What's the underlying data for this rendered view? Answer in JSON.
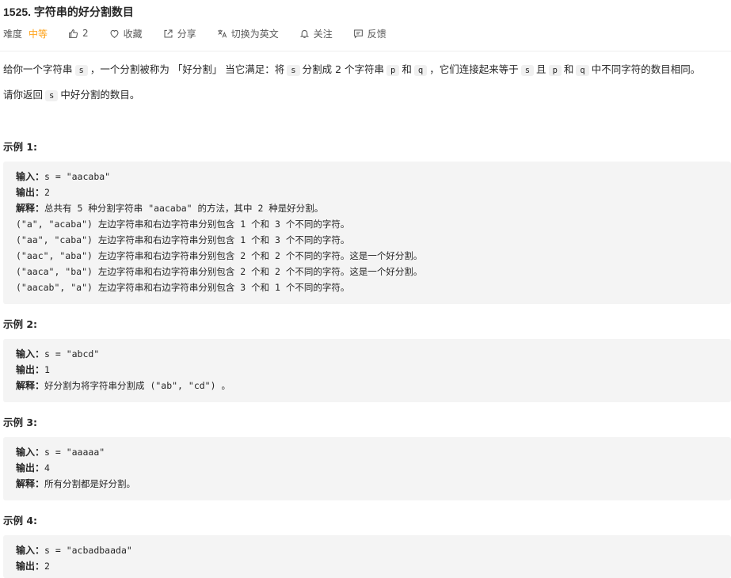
{
  "problem": {
    "title": "1525. 字符串的好分割数目",
    "difficulty_label": "难度",
    "difficulty": "中等",
    "likes": "2",
    "favorite": "收藏",
    "share": "分享",
    "translate": "切换为英文",
    "follow": "关注",
    "feedback": "反馈"
  },
  "description": {
    "p1": [
      "给你一个字符串",
      "s",
      "，一个分割被称为 「好分割」 当它满足：将",
      "s",
      "分割成 2 个字符串",
      "p",
      "和",
      "q",
      "，它们连接起来等于",
      "s",
      "且",
      "p",
      "和",
      "q",
      "中不同字符的数目相同。"
    ],
    "p2": [
      "请你返回",
      "s",
      "中好分割的数目。"
    ]
  },
  "examples": [
    {
      "title": "示例 1:",
      "input_label": "输入：",
      "input": "s = \"aacaba\"",
      "output_label": "输出：",
      "output": "2",
      "explain_label": "解释：",
      "explain_lines": [
        "总共有 5 种分割字符串 \"aacaba\" 的方法，其中 2 种是好分割。",
        "(\"a\", \"acaba\") 左边字符串和右边字符串分别包含 1 个和 3 个不同的字符。",
        "(\"aa\", \"caba\") 左边字符串和右边字符串分别包含 1 个和 3 个不同的字符。",
        "(\"aac\", \"aba\") 左边字符串和右边字符串分别包含 2 个和 2 个不同的字符。这是一个好分割。",
        "(\"aaca\", \"ba\") 左边字符串和右边字符串分别包含 2 个和 2 个不同的字符。这是一个好分割。",
        "(\"aacab\", \"a\") 左边字符串和右边字符串分别包含 3 个和 1 个不同的字符。"
      ]
    },
    {
      "title": "示例 2:",
      "input_label": "输入：",
      "input": "s = \"abcd\"",
      "output_label": "输出：",
      "output": "1",
      "explain_label": "解释：",
      "explain_lines": [
        "好分割为将字符串分割成 (\"ab\", \"cd\") 。"
      ]
    },
    {
      "title": "示例 3:",
      "input_label": "输入：",
      "input": "s = \"aaaaa\"",
      "output_label": "输出：",
      "output": "4",
      "explain_label": "解释：",
      "explain_lines": [
        "所有分割都是好分割。"
      ]
    },
    {
      "title": "示例 4:",
      "input_label": "输入：",
      "input": "s = \"acbadbaada\"",
      "output_label": "输出：",
      "output": "2"
    }
  ],
  "colors": {
    "accent": "#ffa116",
    "code_bg": "#f4f4f4",
    "text": "#262626",
    "muted": "#595959"
  },
  "icons": [
    "thumb-up-icon",
    "heart-icon",
    "share-icon",
    "translate-icon",
    "bell-icon",
    "feedback-icon"
  ]
}
